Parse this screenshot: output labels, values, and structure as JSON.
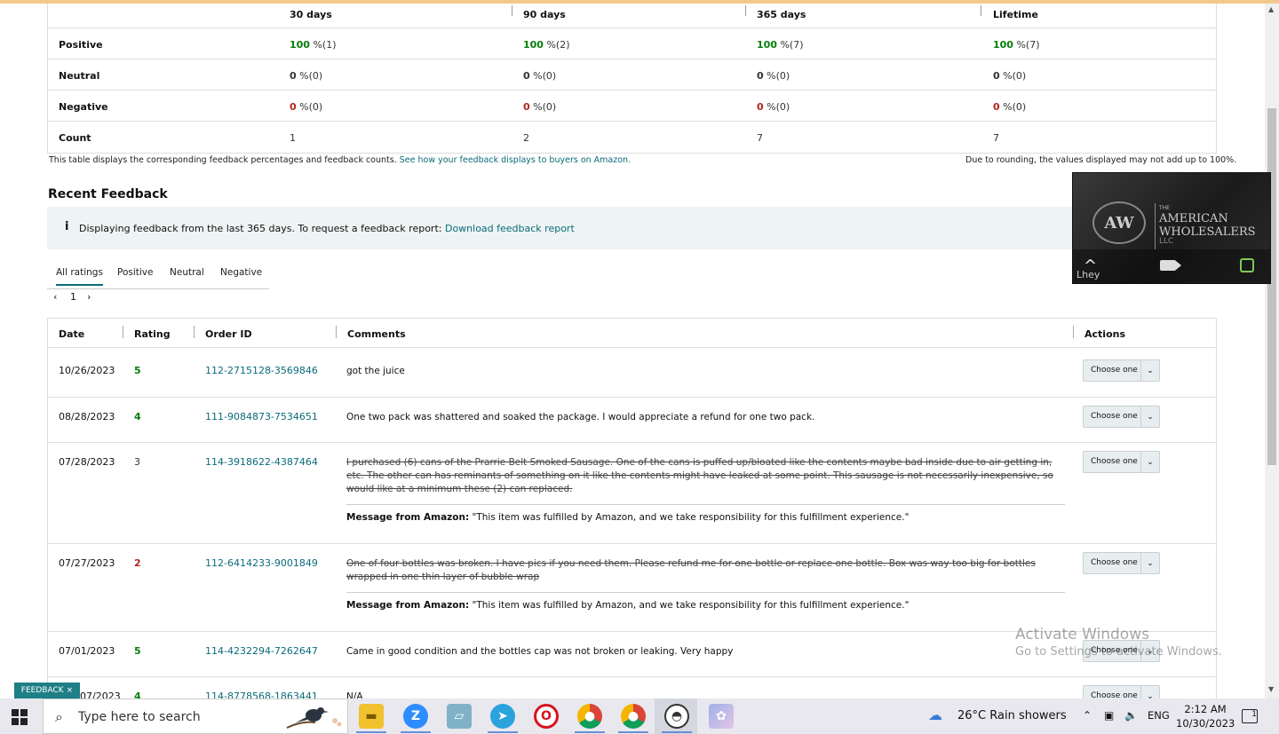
{
  "summary": {
    "headers": [
      "30 days",
      "90 days",
      "365 days",
      "Lifetime"
    ],
    "rows": [
      {
        "label": "Positive",
        "cells": [
          {
            "pct": "100",
            "rest": " %(1)"
          },
          {
            "pct": "100",
            "rest": " %(2)"
          },
          {
            "pct": "100",
            "rest": " %(7)"
          },
          {
            "pct": "100",
            "rest": " %(7)"
          }
        ]
      },
      {
        "label": "Neutral",
        "cells": [
          {
            "pct": "0",
            "rest": " %(0)"
          },
          {
            "pct": "0",
            "rest": " %(0)"
          },
          {
            "pct": "0",
            "rest": " %(0)"
          },
          {
            "pct": "0",
            "rest": " %(0)"
          }
        ]
      },
      {
        "label": "Negative",
        "cells": [
          {
            "pct": "0",
            "rest": " %(0)"
          },
          {
            "pct": "0",
            "rest": " %(0)"
          },
          {
            "pct": "0",
            "rest": " %(0)"
          },
          {
            "pct": "0",
            "rest": " %(0)"
          }
        ]
      },
      {
        "label": "Count",
        "cells": [
          {
            "pct": "",
            "rest": "1"
          },
          {
            "pct": "",
            "rest": "2"
          },
          {
            "pct": "",
            "rest": "7"
          },
          {
            "pct": "",
            "rest": "7"
          }
        ]
      }
    ],
    "note_left": "This table displays the corresponding feedback percentages and feedback counts.",
    "note_link": "See how your feedback displays to buyers on Amazon.",
    "note_right": "Due to rounding, the values displayed may not add up to 100%."
  },
  "recent": {
    "title": "Recent Feedback",
    "info_icon": "i",
    "info_text": "Displaying feedback from the last 365 days. To request a feedback report:",
    "info_link": "Download feedback report",
    "tabs": [
      "All ratings",
      "Positive",
      "Neutral",
      "Negative"
    ],
    "page": "1",
    "prev_icon": "‹",
    "next_icon": "›"
  },
  "feedback_table": {
    "headers": [
      "Date",
      "Rating",
      "Order ID",
      "Comments",
      "Actions"
    ],
    "action_label": "Choose one",
    "message_label": "Message from Amazon:",
    "message_text": "\"This item was fulfilled by Amazon, and we take responsibility for this fulfillment experience.\"",
    "rows": [
      {
        "date": "10/26/2023",
        "rating": "5",
        "order": "112-2715128-3569846",
        "comment": "got the juice",
        "struck": false
      },
      {
        "date": "08/28/2023",
        "rating": "4",
        "order": "111-9084873-7534651",
        "comment": "One two pack was shattered and soaked the package. I would appreciate a refund for one two pack.",
        "struck": false
      },
      {
        "date": "07/28/2023",
        "rating": "3",
        "order": "114-3918622-4387464",
        "comment": "I purchased (6) cans of the Prarrie Belt Smoked Sausage. One of the cans is puffed up/bloated like the contents maybe bad inside due to air getting in, etc. The other can has reminants of something on it like the contents might have leaked at some point. This sausage is not necessarily inexpensive, so would like at a minimum these (2) can replaced.",
        "struck": true
      },
      {
        "date": "07/27/2023",
        "rating": "2",
        "order": "112-6414233-9001849",
        "comment": "One of four bottles was broken. I have pics if you need them. Please refund me for one bottle or replace one bottle. Box was way too big for bottles wrapped in one thin layer of bubble wrap",
        "struck": true
      },
      {
        "date": "07/01/2023",
        "rating": "5",
        "order": "114-4232294-7262647",
        "comment": "Came in good condition and the bottles cap was not broken or leaking. Very happy",
        "struck": false
      },
      {
        "date": "07/2023",
        "rating": "4",
        "order": "114-8778568-1863441",
        "comment": "N/A",
        "struck": false
      }
    ]
  },
  "video": {
    "logo_text": "AW",
    "brand_the": "THE",
    "brand_line1": "AMERICAN",
    "brand_line2": "WHOLESALERS",
    "brand_line3": "LLC",
    "caller_name": "Lhey"
  },
  "feedback_tab": {
    "label": "FEEDBACK",
    "close": "×"
  },
  "watermark": {
    "line1": "Activate Windows",
    "line2": "Go to Settings to activate Windows."
  },
  "taskbar": {
    "search_placeholder": "Type here to search",
    "weather": "26°C  Rain showers",
    "language": "ENG",
    "time": "2:12 AM",
    "date": "10/30/2023",
    "notifications": "1"
  },
  "colors": {
    "positive": "#067d0b",
    "negative": "#b1271f",
    "link": "#0a6b7a",
    "taskbar": "#e8e8ee"
  }
}
